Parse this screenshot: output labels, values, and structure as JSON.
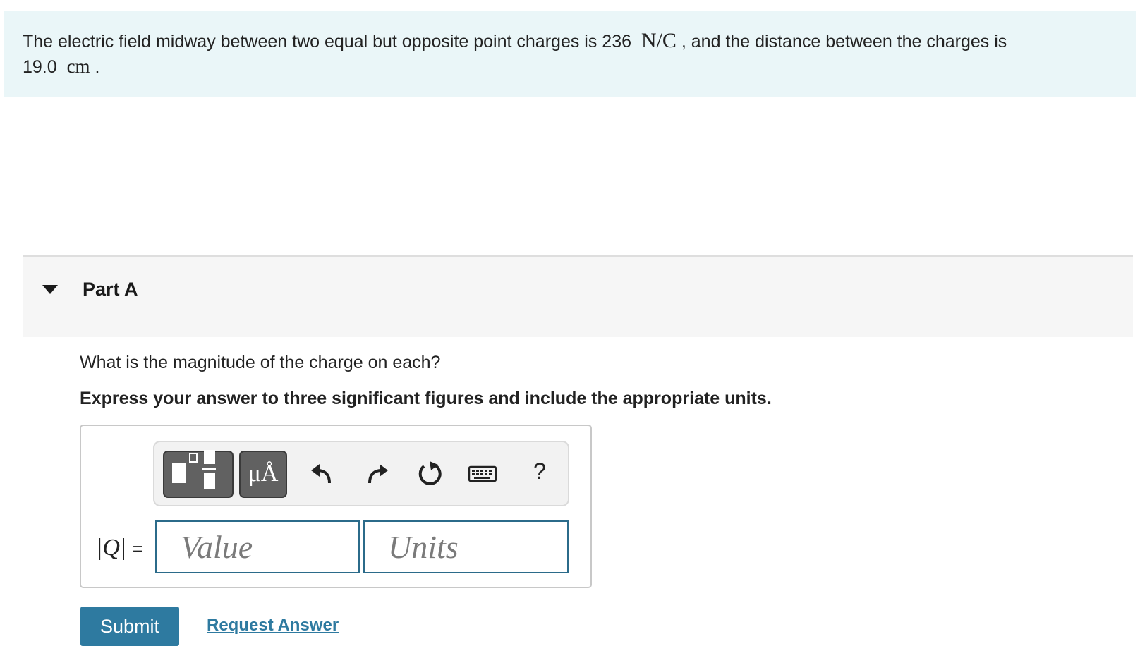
{
  "problem": {
    "text_1": "The electric field midway between two equal but opposite point charges is 236",
    "field_unit": "N/C",
    "text_2": ", and the distance between the charges is",
    "distance_value": "19.0",
    "distance_unit": "cm",
    "text_end": "."
  },
  "part": {
    "title": "Part A",
    "question": "What is the magnitude of the charge on each?",
    "instruction": "Express your answer to three significant figures and include the appropriate units."
  },
  "toolbar": {
    "units_glyph": "μÅ",
    "help_glyph": "?",
    "icons": [
      "templates-icon",
      "units-icon",
      "undo-icon",
      "redo-icon",
      "reset-icon",
      "keyboard-icon",
      "help-icon"
    ]
  },
  "answer": {
    "label_var": "|Q|",
    "label_eq": "=",
    "value": "",
    "value_placeholder": "Value",
    "units": "",
    "units_placeholder": "Units"
  },
  "actions": {
    "submit_label": "Submit",
    "request_label": "Request Answer"
  },
  "colors": {
    "problem_bg": "#eaf6f8",
    "accent": "#2e7aa0",
    "input_border": "#2b6b8a",
    "tool_button": "#616161"
  }
}
